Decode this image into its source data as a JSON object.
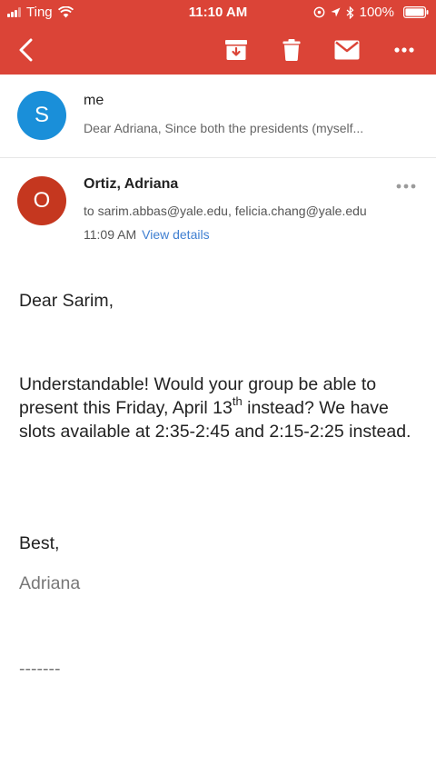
{
  "status_bar": {
    "carrier": "Ting",
    "time": "11:10 AM",
    "battery": "100%"
  },
  "toolbar": {
    "icons": [
      "back-arrow-icon",
      "archive-icon",
      "trash-icon",
      "mail-icon",
      "more-horizontal-icon"
    ],
    "background_color": "#db4437"
  },
  "thread_item": {
    "avatar_letter": "S",
    "avatar_color": "#1a8fd9",
    "sender": "me",
    "snippet": "Dear Adriana, Since both the presidents (myself..."
  },
  "message": {
    "avatar_letter": "O",
    "avatar_color": "#c5371f",
    "from": "Ortiz, Adriana",
    "to": "to sarim.abbas@yale.edu, felicia.chang@yale.edu",
    "time": "11:09 AM",
    "view_details": "View details",
    "body": {
      "greeting": "Dear Sarim,",
      "para_part1": "Understandable! Would your group be able to present this Friday, April 13",
      "para_sup": "th",
      "para_part2": " instead? We have slots available at 2:35-2:45 and 2:15-2:25 instead.",
      "closing": "Best,",
      "signature": "Adriana",
      "separator": "-------"
    }
  }
}
